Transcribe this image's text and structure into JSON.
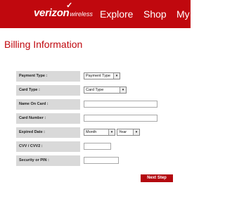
{
  "header": {
    "logo_checkmark": "✓",
    "logo_main": "verizon",
    "logo_sub": "wireless",
    "nav": [
      "Explore",
      "Shop",
      "My"
    ]
  },
  "page": {
    "title": "Billing Information"
  },
  "form": {
    "payment_type": {
      "label": "Payment Type :",
      "value": "Payment Type"
    },
    "card_type": {
      "label": "Card Type :",
      "value": "Card Type"
    },
    "name_on_card": {
      "label": "Name On Card :",
      "value": ""
    },
    "card_number": {
      "label": "Card Number :",
      "value": ""
    },
    "expired_date": {
      "label": "Expired Date :",
      "month": "Month",
      "year": "Year"
    },
    "cvv": {
      "label": "CVV / CVV2 :",
      "value": ""
    },
    "security": {
      "label": "Security or PIN :",
      "value": ""
    },
    "next_label": "Next Step"
  },
  "colors": {
    "brand_red": "#c0080e",
    "label_bg": "#d9d9d9",
    "button_red": "#b3090f"
  }
}
